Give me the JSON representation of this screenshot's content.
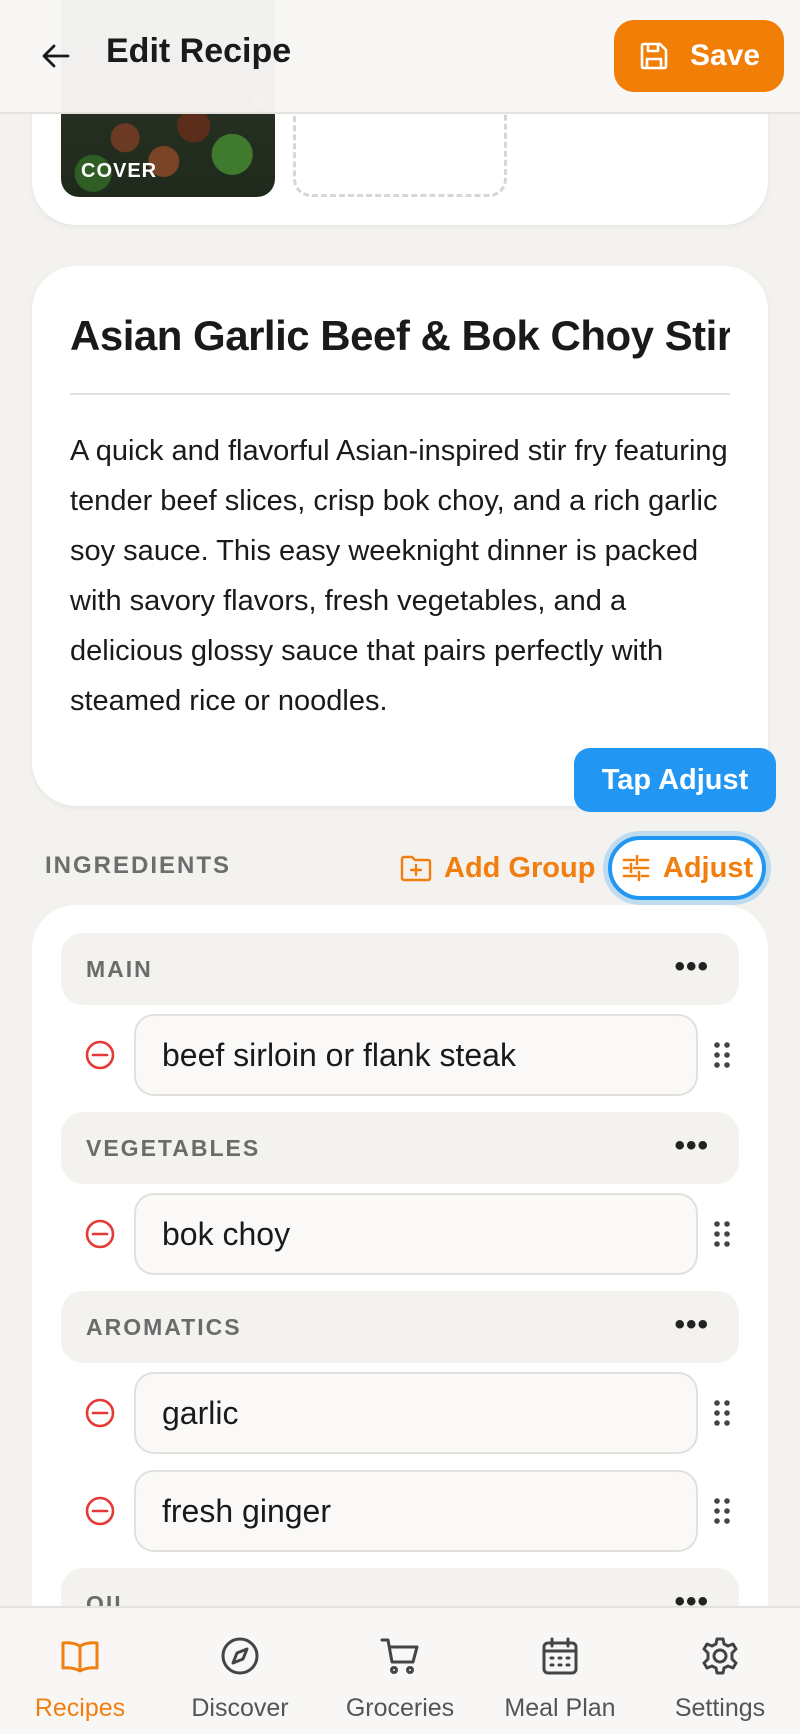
{
  "header": {
    "title": "Edit Recipe",
    "save_label": "Save"
  },
  "photos": {
    "cover_label": "COVER"
  },
  "recipe": {
    "title": "Asian Garlic Beef & Bok Choy Stir",
    "description": "A quick and flavorful Asian-inspired stir fry featuring tender beef slices, crisp bok choy, and a rich garlic soy sauce. This easy weeknight dinner is packed with savory flavors, fresh vegetables, and a delicious glossy sauce that pairs perfectly with steamed rice or noodles."
  },
  "tooltip": "Tap Adjust",
  "ingredients": {
    "header": "INGREDIENTS",
    "add_group_label": "Add Group",
    "adjust_label": "Adjust",
    "groups": [
      {
        "name": "MAIN",
        "items": [
          "beef sirloin or flank steak"
        ]
      },
      {
        "name": "VEGETABLES",
        "items": [
          "bok choy"
        ]
      },
      {
        "name": "AROMATICS",
        "items": [
          "garlic",
          "fresh ginger"
        ]
      },
      {
        "name": "OIL",
        "items": []
      }
    ],
    "more_glyph": "•••"
  },
  "tabs": [
    {
      "label": "Recipes",
      "icon": "book-icon",
      "active": true
    },
    {
      "label": "Discover",
      "icon": "compass-icon",
      "active": false
    },
    {
      "label": "Groceries",
      "icon": "cart-icon",
      "active": false
    },
    {
      "label": "Meal Plan",
      "icon": "calendar-icon",
      "active": false
    },
    {
      "label": "Settings",
      "icon": "gear-icon",
      "active": false
    }
  ],
  "colors": {
    "accent": "#f17f07",
    "highlight": "#2196f3",
    "remove": "#e53935"
  }
}
